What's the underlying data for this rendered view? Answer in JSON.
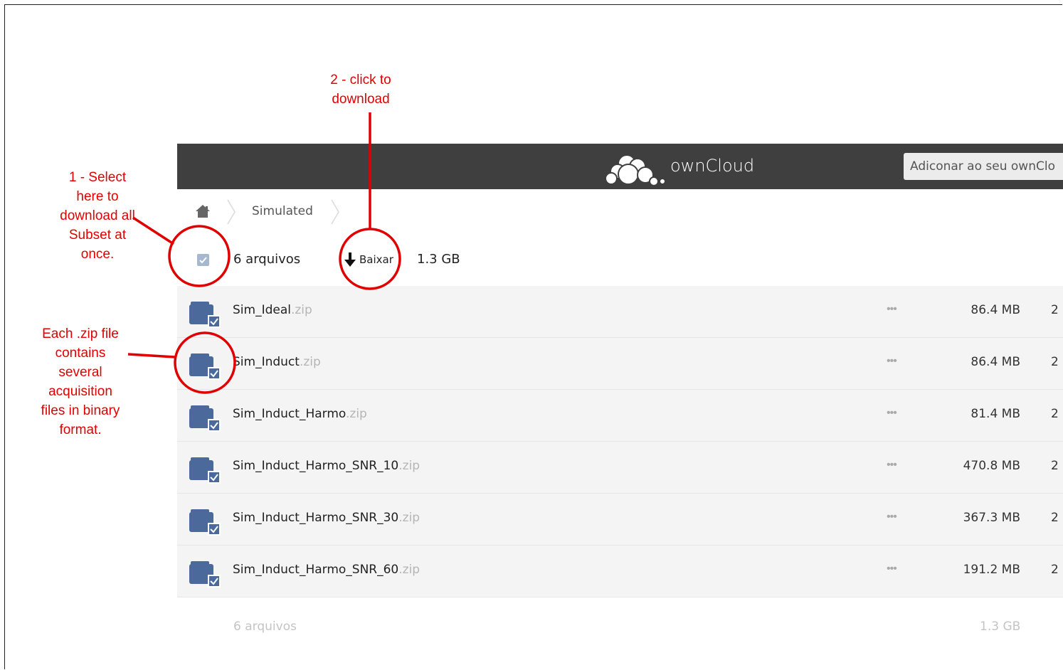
{
  "header": {
    "brand": "ownCloud",
    "add_button_label": "Adiconar ao seu ownClo"
  },
  "breadcrumb": {
    "items": [
      "Simulated"
    ]
  },
  "summary": {
    "count": "6 arquivos",
    "download_label": "Baixar",
    "total_size": "1.3 GB"
  },
  "files": [
    {
      "base": "Sim_Ideal",
      "ext": ".zip",
      "actions": "•••",
      "size": "86.4 MB",
      "date": "2"
    },
    {
      "base": "Sim_Induct",
      "ext": ".zip",
      "actions": "•••",
      "size": "86.4 MB",
      "date": "2"
    },
    {
      "base": "Sim_Induct_Harmo",
      "ext": ".zip",
      "actions": "•••",
      "size": "81.4 MB",
      "date": "2"
    },
    {
      "base": "Sim_Induct_Harmo_SNR_10",
      "ext": ".zip",
      "actions": "•••",
      "size": "470.8 MB",
      "date": "2"
    },
    {
      "base": "Sim_Induct_Harmo_SNR_30",
      "ext": ".zip",
      "actions": "•••",
      "size": "367.3 MB",
      "date": "2"
    },
    {
      "base": "Sim_Induct_Harmo_SNR_60",
      "ext": ".zip",
      "actions": "•••",
      "size": "191.2 MB",
      "date": "2"
    }
  ],
  "footer": {
    "count": "6 arquivos",
    "total_size": "1.3 GB"
  },
  "annotations": {
    "step1_lines": [
      "1 - Select",
      "here to",
      "download all",
      "Subset at",
      "once."
    ],
    "step2_lines": [
      "2 - click to",
      "download"
    ],
    "zip_lines": [
      "Each .zip file",
      "contains",
      "several",
      "acquisition",
      "files in binary",
      "format."
    ]
  },
  "colors": {
    "annotation_red": "#e00000",
    "header_bg": "#3f3f3f",
    "folder_blue": "#4b6a9b",
    "row_bg": "#f4f4f4"
  },
  "icons": {
    "home": "home-icon",
    "download": "download-arrow-icon",
    "file": "zip-archive-icon",
    "checkbox": "checkbox-checked-icon",
    "actions": "more-actions-icon",
    "logo": "owncloud-logo-icon"
  }
}
